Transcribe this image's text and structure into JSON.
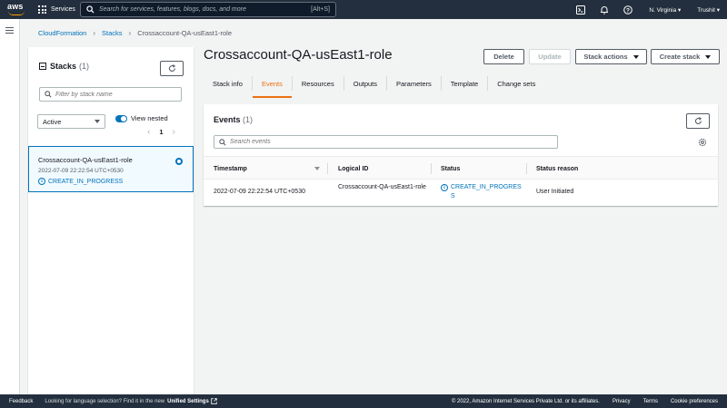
{
  "topnav": {
    "logo_text": "aws",
    "services_label": "Services",
    "search_placeholder": "Search for services, features, blogs, docs, and more",
    "search_shortcut": "[Alt+S]",
    "region": "N. Virginia",
    "user": "Trushit"
  },
  "breadcrumb": [
    "CloudFormation",
    "Stacks",
    "Crossaccount-QA-usEast1-role"
  ],
  "stacks_panel": {
    "title": "Stacks",
    "count": "(1)",
    "filter_placeholder": "Filter by stack name",
    "status_filter": "Active",
    "view_nested_label": "View nested",
    "page": "1",
    "stack": {
      "name": "Crossaccount-QA-usEast1-role",
      "time": "2022-07-09 22:22:54 UTC+0530",
      "status": "CREATE_IN_PROGRESS"
    }
  },
  "main": {
    "title": "Crossaccount-QA-usEast1-role",
    "buttons": {
      "delete": "Delete",
      "update": "Update",
      "stack_actions": "Stack actions",
      "create_stack": "Create stack"
    },
    "tabs": [
      "Stack info",
      "Events",
      "Resources",
      "Outputs",
      "Parameters",
      "Template",
      "Change sets"
    ],
    "active_tab": "Events"
  },
  "events": {
    "title": "Events",
    "count": "(1)",
    "search_placeholder": "Search events",
    "columns": [
      "Timestamp",
      "Logical ID",
      "Status",
      "Status reason"
    ],
    "rows": [
      {
        "timestamp": "2022-07-09 22:22:54 UTC+0530",
        "logical_id": "Crossaccount-QA-usEast1-role",
        "status": "CREATE_IN_PROGRESS",
        "reason": "User Initiated"
      }
    ]
  },
  "footer": {
    "feedback": "Feedback",
    "language_prompt": "Looking for language selection? Find it in the new",
    "unified_settings": "Unified Settings",
    "copyright": "© 2022, Amazon Internet Services Private Ltd. or its affiliates.",
    "privacy": "Privacy",
    "terms": "Terms",
    "cookies": "Cookie preferences"
  },
  "colors": {
    "nav_bg": "#232f3e",
    "accent_orange": "#ec7211",
    "link_blue": "#0073bb",
    "page_bg": "#f2f3f3"
  }
}
